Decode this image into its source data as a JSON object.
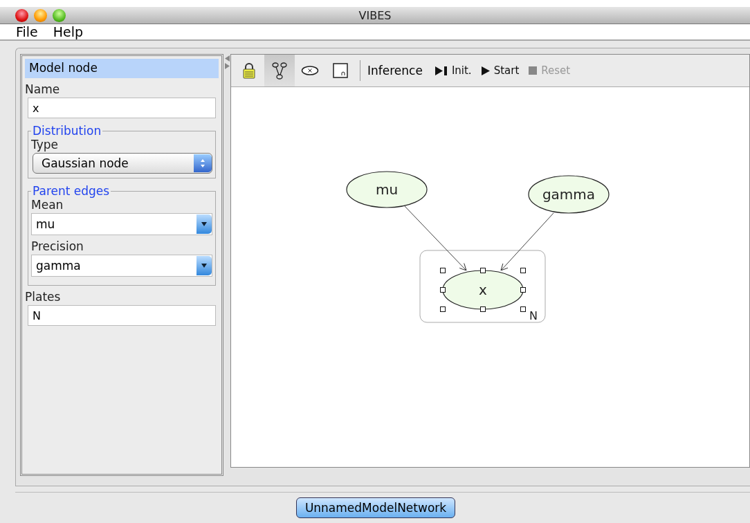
{
  "window": {
    "title": "VIBES"
  },
  "menu": [
    "File",
    "Help"
  ],
  "properties": {
    "header": "Model node",
    "name": {
      "label": "Name",
      "value": "x"
    },
    "distribution": {
      "legend": "Distribution",
      "type_label": "Type",
      "type_value": "Gaussian node"
    },
    "parent_edges": {
      "legend": "Parent edges",
      "fields": [
        {
          "label": "Mean",
          "value": "mu"
        },
        {
          "label": "Precision",
          "value": "gamma"
        }
      ]
    },
    "plates": {
      "label": "Plates",
      "value": "N"
    }
  },
  "toolbar": {
    "tools": [
      {
        "kind": "lock",
        "selected": false
      },
      {
        "kind": "edge",
        "selected": true
      },
      {
        "kind": "node",
        "selected": false
      },
      {
        "kind": "plate",
        "selected": false
      }
    ],
    "inference_label": "Inference",
    "actions": [
      {
        "kind": "step",
        "label": "Init.",
        "disabled": false
      },
      {
        "kind": "play",
        "label": "Start",
        "disabled": false
      },
      {
        "kind": "stop",
        "label": "Reset",
        "disabled": true
      }
    ]
  },
  "graph": {
    "nodes": [
      {
        "label": "mu",
        "selected": false
      },
      {
        "label": "gamma",
        "selected": false
      },
      {
        "label": "x",
        "selected": true
      }
    ],
    "plate": {
      "label": "N"
    }
  },
  "network_tab": "UnnamedModelNetwork"
}
